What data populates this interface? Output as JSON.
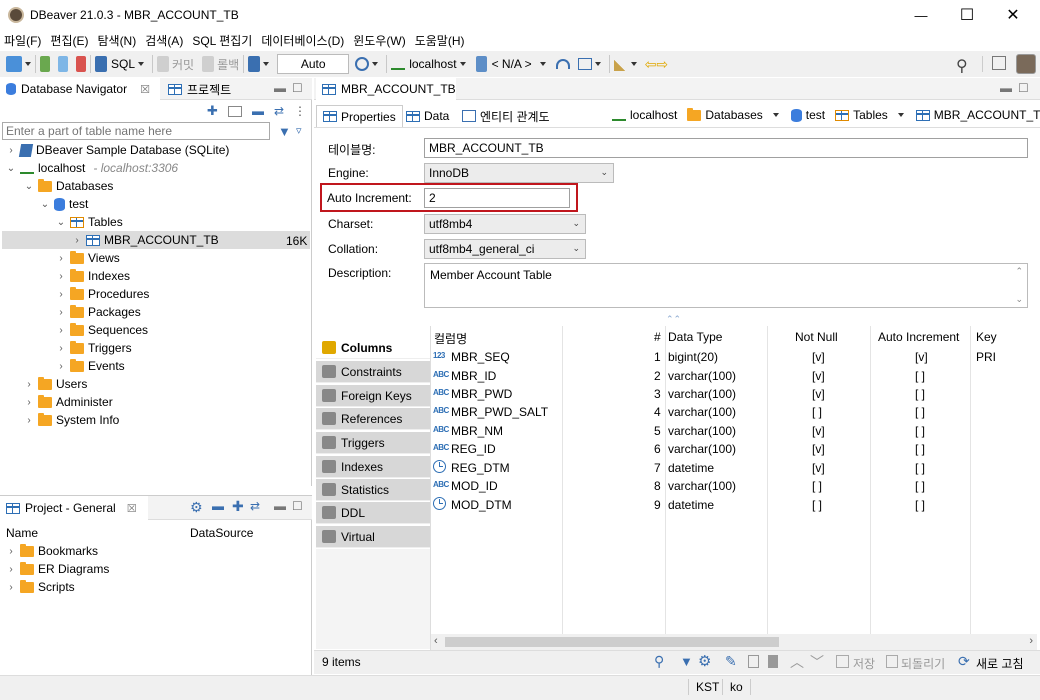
{
  "window": {
    "title": "DBeaver 21.0.3 - MBR_ACCOUNT_TB",
    "minimize": "—",
    "maximize": "☐",
    "close": "✕"
  },
  "menu": [
    "파일(F)",
    "편집(E)",
    "탐색(N)",
    "검색(A)",
    "SQL 편집기",
    "데이터베이스(D)",
    "윈도우(W)",
    "도움말(H)"
  ],
  "toolbar": {
    "sql_label": "SQL",
    "commit_label": "커밋",
    "rollback_label": "롤백",
    "tx_mode": "Auto",
    "connection": "localhost",
    "schema": "< N/A >"
  },
  "navigator": {
    "tab_label": "Database Navigator",
    "project_tab_label": "프로젝트",
    "filter_placeholder": "Enter a part of table name here",
    "items": [
      {
        "label": "DBeaver Sample Database (SQLite)"
      },
      {
        "label": "localhost",
        "sub": "- localhost:3306"
      },
      {
        "label": "Databases"
      },
      {
        "label": "test"
      },
      {
        "label": "Tables"
      },
      {
        "label": "MBR_ACCOUNT_TB",
        "size": "16K"
      },
      {
        "label": "Views"
      },
      {
        "label": "Indexes"
      },
      {
        "label": "Procedures"
      },
      {
        "label": "Packages"
      },
      {
        "label": "Sequences"
      },
      {
        "label": "Triggers"
      },
      {
        "label": "Events"
      },
      {
        "label": "Users"
      },
      {
        "label": "Administer"
      },
      {
        "label": "System Info"
      }
    ]
  },
  "project": {
    "tab_label": "Project - General",
    "col_name": "Name",
    "col_datasource": "DataSource",
    "items": [
      {
        "label": "Bookmarks"
      },
      {
        "label": "ER Diagrams"
      },
      {
        "label": "Scripts"
      }
    ]
  },
  "editor": {
    "tab_label": "MBR_ACCOUNT_TB",
    "subtabs": [
      "Properties",
      "Data",
      "엔티티 관계도"
    ],
    "breadcrumb": [
      "localhost",
      "Databases",
      "test",
      "Tables",
      "MBR_ACCOUNT_TB"
    ],
    "props": {
      "table_name_label": "테이블명:",
      "table_name": "MBR_ACCOUNT_TB",
      "engine_label": "Engine:",
      "engine": "InnoDB",
      "auto_inc_label": "Auto Increment:",
      "auto_inc": "2",
      "charset_label": "Charset:",
      "charset": "utf8mb4",
      "collation_label": "Collation:",
      "collation": "utf8mb4_general_ci",
      "description_label": "Description:",
      "description": "Member Account Table"
    },
    "side_tabs": [
      "Columns",
      "Constraints",
      "Foreign Keys",
      "References",
      "Triggers",
      "Indexes",
      "Statistics",
      "DDL",
      "Virtual"
    ],
    "columns_header": [
      "컬럼명",
      "#",
      "Data Type",
      "Not Null",
      "Auto Increment",
      "Key"
    ],
    "columns": [
      {
        "icon": "123",
        "name": "MBR_SEQ",
        "num": "1",
        "type": "bigint(20)",
        "notnull": "[v]",
        "autoinc": "[v]",
        "key": "PRI"
      },
      {
        "icon": "ABC",
        "name": "MBR_ID",
        "num": "2",
        "type": "varchar(100)",
        "notnull": "[v]",
        "autoinc": "[ ]",
        "key": ""
      },
      {
        "icon": "ABC",
        "name": "MBR_PWD",
        "num": "3",
        "type": "varchar(100)",
        "notnull": "[v]",
        "autoinc": "[ ]",
        "key": ""
      },
      {
        "icon": "ABC",
        "name": "MBR_PWD_SALT",
        "num": "4",
        "type": "varchar(100)",
        "notnull": "[ ]",
        "autoinc": "[ ]",
        "key": ""
      },
      {
        "icon": "ABC",
        "name": "MBR_NM",
        "num": "5",
        "type": "varchar(100)",
        "notnull": "[v]",
        "autoinc": "[ ]",
        "key": ""
      },
      {
        "icon": "ABC",
        "name": "REG_ID",
        "num": "6",
        "type": "varchar(100)",
        "notnull": "[v]",
        "autoinc": "[ ]",
        "key": ""
      },
      {
        "icon": "clock",
        "name": "REG_DTM",
        "num": "7",
        "type": "datetime",
        "notnull": "[v]",
        "autoinc": "[ ]",
        "key": ""
      },
      {
        "icon": "ABC",
        "name": "MOD_ID",
        "num": "8",
        "type": "varchar(100)",
        "notnull": "[ ]",
        "autoinc": "[ ]",
        "key": ""
      },
      {
        "icon": "clock",
        "name": "MOD_DTM",
        "num": "9",
        "type": "datetime",
        "notnull": "[ ]",
        "autoinc": "[ ]",
        "key": ""
      }
    ],
    "item_count": "9 items",
    "save_label": "저장",
    "revert_label": "되돌리기",
    "refresh_label": "새로 고침"
  },
  "status": {
    "timezone": "KST",
    "locale": "ko"
  },
  "colors": {
    "highlight_border": "#c0161d",
    "selection": "#dcdcdc",
    "accent": "#2e6fb5"
  }
}
